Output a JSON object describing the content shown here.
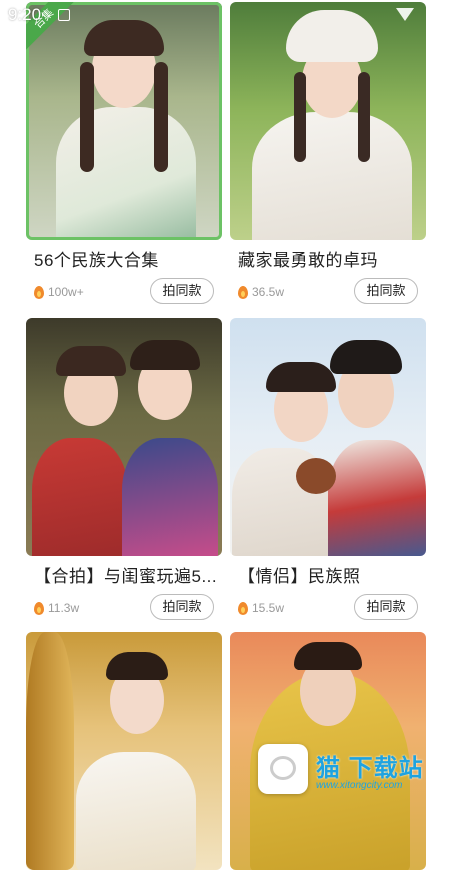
{
  "status": {
    "time": "9:20"
  },
  "cards": [
    {
      "title": "56个民族大合集",
      "count": "100w+",
      "button": "拍同款",
      "badge": "合集",
      "selected": true
    },
    {
      "title": "藏家最勇敢的卓玛",
      "count": "36.5w",
      "button": "拍同款"
    },
    {
      "title": "【合拍】与闺蜜玩遍5...",
      "count": "11.3w",
      "button": "拍同款"
    },
    {
      "title": "【情侣】民族照",
      "count": "15.5w",
      "button": "拍同款"
    },
    {
      "title": "",
      "count": "",
      "button": ""
    },
    {
      "title": "",
      "count": "",
      "button": ""
    }
  ],
  "watermark": {
    "title": "猫 下载站",
    "url": "www.xitongcity.com"
  },
  "colors": {
    "accent_green": "#6cc265",
    "fire": "#f08a2c",
    "watermark_blue": "#1fa3e0"
  }
}
